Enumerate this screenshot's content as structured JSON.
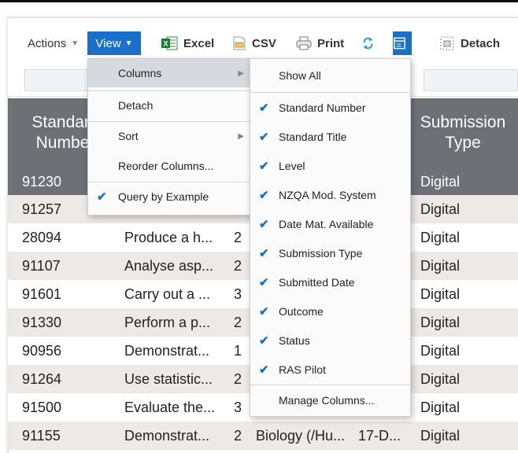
{
  "toolbar": {
    "actions": "Actions",
    "view": "View",
    "excel": "Excel",
    "csv": "CSV",
    "print": "Print",
    "detach": "Detach"
  },
  "table": {
    "headers": {
      "standard_number": "Standard Number",
      "submission_type": "Submission Type"
    },
    "rows": [
      {
        "num": "91230",
        "title": "",
        "level": "",
        "system": "",
        "date": "",
        "type": "Digital"
      },
      {
        "num": "91257",
        "title": "",
        "level": "",
        "system": "",
        "date": "",
        "type": "Digital"
      },
      {
        "num": "28094",
        "title": "Produce a h...",
        "level": "2",
        "system": "",
        "date": "",
        "type": "Digital"
      },
      {
        "num": "91107",
        "title": "Analyse asp...",
        "level": "2",
        "system": "",
        "date": "",
        "type": "Digital"
      },
      {
        "num": "91601",
        "title": "Carry out a ...",
        "level": "3",
        "system": "",
        "date": "",
        "type": "Digital"
      },
      {
        "num": "91330",
        "title": "Perform a p...",
        "level": "2",
        "system": "",
        "date": "",
        "type": "Digital"
      },
      {
        "num": "90956",
        "title": "Demonstrat...",
        "level": "1",
        "system": "",
        "date": "",
        "type": "Digital"
      },
      {
        "num": "91264",
        "title": "Use statistic...",
        "level": "2",
        "system": "",
        "date": "",
        "type": "Digital"
      },
      {
        "num": "91500",
        "title": "Evaluate the...",
        "level": "3",
        "system": "",
        "date": "",
        "type": "Digital"
      },
      {
        "num": "91155",
        "title": "Demonstrat...",
        "level": "2",
        "system": "Biology (/Hu...",
        "date": "17-D...",
        "type": "Digital"
      }
    ]
  },
  "view_menu": [
    {
      "label": "Columns",
      "submenu": true,
      "checked": false
    },
    {
      "label": "Detach",
      "submenu": false,
      "checked": false
    },
    {
      "label": "Sort",
      "submenu": true,
      "checked": false
    },
    {
      "label": "Reorder Columns...",
      "submenu": false,
      "checked": false
    },
    {
      "label": "Query by Example",
      "submenu": false,
      "checked": true
    }
  ],
  "columns_menu": {
    "show_all": "Show All",
    "columns": [
      {
        "label": "Standard Number",
        "checked": true
      },
      {
        "label": "Standard Title",
        "checked": true
      },
      {
        "label": "Level",
        "checked": true
      },
      {
        "label": "NZQA Mod. System",
        "checked": true
      },
      {
        "label": "Date Mat. Available",
        "checked": true
      },
      {
        "label": "Submission Type",
        "checked": true
      },
      {
        "label": "Submitted Date",
        "checked": true
      },
      {
        "label": "Outcome",
        "checked": true
      },
      {
        "label": "Status",
        "checked": true
      },
      {
        "label": "RAS Pilot",
        "checked": true
      }
    ],
    "manage": "Manage Columns..."
  },
  "colors": {
    "accent": "#1a6fc9",
    "header_bg": "#6d7176",
    "stripe": "#ede9e6"
  }
}
